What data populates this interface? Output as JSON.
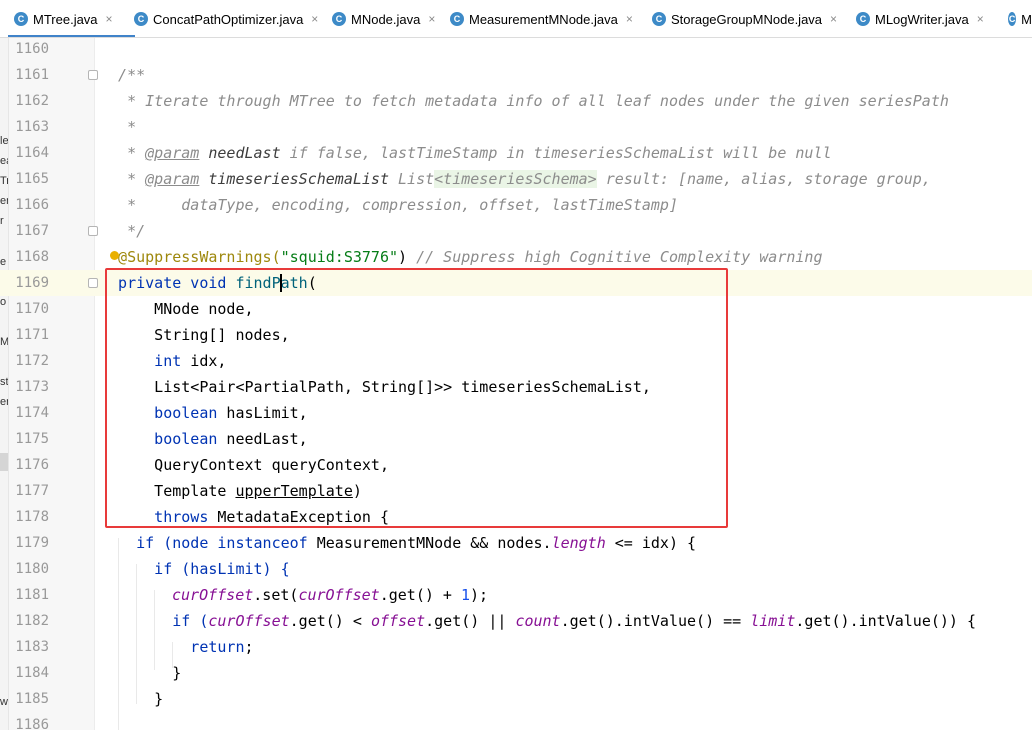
{
  "tabs": [
    {
      "label": "MTree.java",
      "active": true
    },
    {
      "label": "ConcatPathOptimizer.java",
      "active": false
    },
    {
      "label": "MNode.java",
      "active": false
    },
    {
      "label": "MeasurementMNode.java",
      "active": false
    },
    {
      "label": "StorageGroupMNode.java",
      "active": false
    },
    {
      "label": "MLogWriter.java",
      "active": false
    },
    {
      "label": "M",
      "active": false
    }
  ],
  "tab_icon_letter": "C",
  "tab_close_glyph": "×",
  "left_fragments": [
    "le",
    "ea",
    "Tr",
    "er",
    "r",
    "e",
    "o",
    "M",
    "st",
    "er",
    "w"
  ],
  "lines": [
    {
      "n": "1160"
    },
    {
      "n": "1161"
    },
    {
      "n": "1162"
    },
    {
      "n": "1163"
    },
    {
      "n": "1164"
    },
    {
      "n": "1165"
    },
    {
      "n": "1166"
    },
    {
      "n": "1167"
    },
    {
      "n": "1168"
    },
    {
      "n": "1169"
    },
    {
      "n": "1170"
    },
    {
      "n": "1171"
    },
    {
      "n": "1172"
    },
    {
      "n": "1173"
    },
    {
      "n": "1174"
    },
    {
      "n": "1175"
    },
    {
      "n": "1176"
    },
    {
      "n": "1177"
    },
    {
      "n": "1178"
    },
    {
      "n": "1179"
    },
    {
      "n": "1180"
    },
    {
      "n": "1181"
    },
    {
      "n": "1182"
    },
    {
      "n": "1183"
    },
    {
      "n": "1184"
    },
    {
      "n": "1185"
    },
    {
      "n": "1186"
    }
  ],
  "code": {
    "l1161": "  /**",
    "l1162": "   * Iterate through MTree to fetch metadata info of all leaf nodes under the given seriesPath",
    "l1163": "   *",
    "l1164_a": "   * ",
    "l1164_tag": "@param",
    "l1164_ref": " needLast",
    "l1164_b": " if false, lastTimeStamp in timeseriesSchemaList will be null",
    "l1165_a": "   * ",
    "l1165_tag": "@param",
    "l1165_ref": " timeseriesSchemaList",
    "l1165_b": " List",
    "l1165_gen": "<timeseriesSchema>",
    "l1165_c": " result: [name, alias, storage group,",
    "l1166": "   *     dataType, encoding, compression, offset, lastTimeStamp]",
    "l1167": "   */",
    "l1168_ann": "  @SuppressWarnings(",
    "l1168_str": "\"squid:S3776\"",
    "l1168_close": ")",
    "l1168_cmt": " // Suppress high Cognitive Complexity warning",
    "l1169_kw": "  private void ",
    "l1169_fn": "findPath",
    "l1169_p": "(",
    "l1170": "      MNode node,",
    "l1171": "      String[] nodes,",
    "l1172_kw": "      int",
    "l1172_b": " idx,",
    "l1173": "      List<Pair<PartialPath, String[]>> timeseriesSchemaList,",
    "l1174_kw": "      boolean",
    "l1174_b": " hasLimit,",
    "l1175_kw": "      boolean",
    "l1175_b": " needLast,",
    "l1176": "      QueryContext queryContext,",
    "l1177_a": "      Template ",
    "l1177_u": "upperTemplate",
    "l1177_b": ")",
    "l1178_kw": "      throws",
    "l1178_b": " MetadataException {",
    "l1179_a": "    if (node ",
    "l1179_kw": "instanceof",
    "l1179_b": " MeasurementMNode && nodes.",
    "l1179_f": "length",
    "l1179_c": " <= idx) {",
    "l1180_a": "      if (hasLimit) {",
    "l1181_f1": "curOffset",
    "l1181_a": ".set(",
    "l1181_f2": "curOffset",
    "l1181_b": ".get() + ",
    "l1181_n": "1",
    "l1181_c": ");",
    "l1182_a": "        if (",
    "l1182_f1": "curOffset",
    "l1182_b": ".get() < ",
    "l1182_f2": "offset",
    "l1182_c": ".get() || ",
    "l1182_f3": "count",
    "l1182_d": ".get().intValue() == ",
    "l1182_f4": "limit",
    "l1182_e": ".get().intValue()) {",
    "l1183_kw": "          return",
    "l1183_b": ";",
    "l1184": "        }",
    "l1185": "      }"
  },
  "colors": {
    "keyword": "#0033b3",
    "function": "#00627a",
    "annotation": "#9e880d",
    "string": "#067d17",
    "number": "#1750eb",
    "field": "#871094",
    "comment": "#8c8c8c",
    "highlight_box": "#e83a3a",
    "current_line": "#fcfbe9"
  }
}
